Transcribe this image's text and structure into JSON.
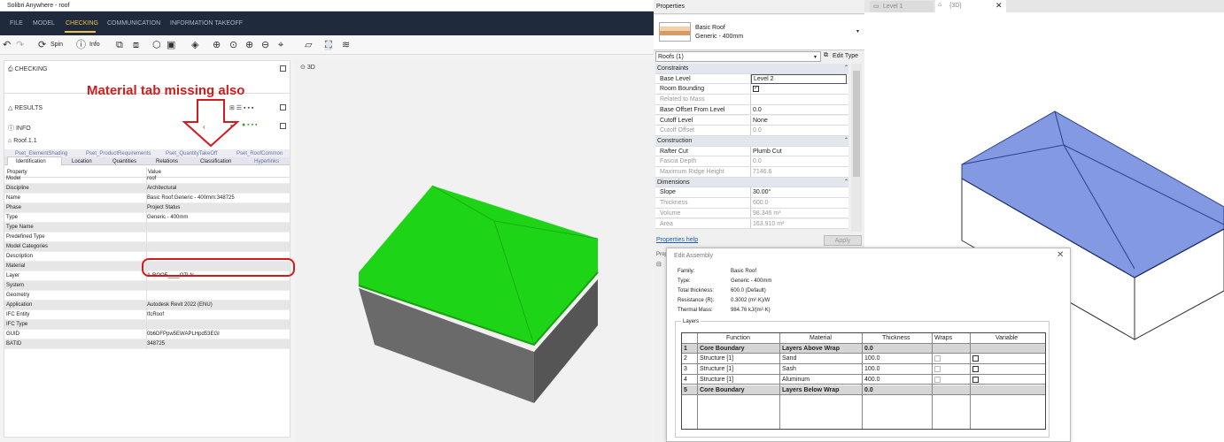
{
  "solibri": {
    "window_title": "Solibri Anywhere - roof",
    "menu": [
      "FILE",
      "MODEL",
      "CHECKING",
      "COMMUNICATION",
      "INFORMATION TAKEOFF"
    ],
    "active_menu": "CHECKING",
    "toolbar": {
      "spin_label": "Spin",
      "info_label": "Info"
    },
    "checking_title": "CHECKING",
    "results_title": "RESULTS",
    "info_title": "INFO",
    "selected_object": "Roof.1.1",
    "tabs_row1": [
      "Pset_ElementShading",
      "Pset_ProductRequirements",
      "Pset_QuantityTakeOff",
      "Pset_RoofCommon"
    ],
    "tabs_row2": [
      "Identification",
      "Location",
      "Quantities",
      "Relations",
      "Classification",
      "Hyperlinks"
    ],
    "selected_tab": "Identification",
    "table_headers": {
      "property": "Property",
      "value": "Value"
    },
    "properties": [
      {
        "name": "Model",
        "value": "roof"
      },
      {
        "name": "Discipline",
        "value": "Architectural"
      },
      {
        "name": "Name",
        "value": "Basic Roof:Generic - 400mm:348725"
      },
      {
        "name": "Phase",
        "value": "Project Status"
      },
      {
        "name": "Type",
        "value": "Generic - 400mm"
      },
      {
        "name": "Type Name",
        "value": ""
      },
      {
        "name": "Predefined Type",
        "value": ""
      },
      {
        "name": "Model Categories",
        "value": ""
      },
      {
        "name": "Description",
        "value": ""
      },
      {
        "name": "Material",
        "value": ""
      },
      {
        "name": "Layer",
        "value": "A-ROOF____OTLN"
      },
      {
        "name": "System",
        "value": ""
      },
      {
        "name": "Geometry",
        "value": ""
      },
      {
        "name": "Application",
        "value": "Autodesk Revit 2022 (ENU)"
      },
      {
        "name": "IFC Entity",
        "value": "IfcRoof"
      },
      {
        "name": "IFC Type",
        "value": ""
      },
      {
        "name": "GUID",
        "value": "0b6DFPpw5EWAPLHpd53EGI"
      },
      {
        "name": "BATID",
        "value": "348725"
      }
    ],
    "view_title": "3D",
    "annotation": "Material tab missing also",
    "colors": {
      "roof_top": "#1ed416",
      "roof_side": "#6e6e6e",
      "annotation": "#d41b1b",
      "menubar": "#1f2a3c",
      "active": "#f0c24a"
    }
  },
  "revit": {
    "properties_title": "Properties",
    "family": "Basic Roof",
    "type": "Generic - 400mm",
    "instance_filter": "Roofs (1)",
    "edit_type_label": "Edit Type",
    "sections": [
      {
        "title": "Constraints",
        "rows": [
          {
            "key": "Base Level",
            "value": "Level 2",
            "grey": false
          },
          {
            "key": "Room Bounding",
            "value": "",
            "check": true,
            "grey": false
          },
          {
            "key": "Related to Mass",
            "value": "",
            "grey": true
          },
          {
            "key": "Base Offset From Level",
            "value": "0.0",
            "grey": false
          },
          {
            "key": "Cutoff Level",
            "value": "None",
            "grey": false
          },
          {
            "key": "Cutoff Offset",
            "value": "0.0",
            "grey": true
          }
        ]
      },
      {
        "title": "Construction",
        "rows": [
          {
            "key": "Rafter Cut",
            "value": "Plumb Cut",
            "grey": false
          },
          {
            "key": "Fascia Depth",
            "value": "0.0",
            "grey": true
          },
          {
            "key": "Maximum Ridge Height",
            "value": "7146.6",
            "grey": true
          }
        ]
      },
      {
        "title": "Dimensions",
        "rows": [
          {
            "key": "Slope",
            "value": "30.00°",
            "grey": false
          },
          {
            "key": "Thickness",
            "value": "600.0",
            "grey": true
          },
          {
            "key": "Volume",
            "value": "98.346 m³",
            "grey": true
          },
          {
            "key": "Area",
            "value": "163.910 m²",
            "grey": true
          }
        ]
      }
    ],
    "properties_help": "Properties help",
    "apply_label": "Apply",
    "view_tabs": [
      "Level 1",
      "{3D}"
    ],
    "dialog": {
      "title": "Edit Assembly",
      "family_label": "Family:",
      "family_value": "Basic Roof",
      "type_label": "Type:",
      "type_value": "Generic - 400mm",
      "thickness_label": "Total thickness:",
      "thickness_value": "600.0 (Default)",
      "resistance_label": "Resistance (R):",
      "resistance_value": "0.3002 (m²·K)/W",
      "mass_label": "Thermal Mass:",
      "mass_value": "984.76 kJ/(m²·K)",
      "layers_label": "Layers",
      "columns": [
        "Function",
        "Material",
        "Thickness",
        "Wraps",
        "Variable"
      ],
      "rows": [
        {
          "n": "1",
          "function": "Core Boundary",
          "material": "Layers Above Wrap",
          "thickness": "0.0",
          "bold": true
        },
        {
          "n": "2",
          "function": "Structure [1]",
          "material": "Sand",
          "thickness": "100.0",
          "bold": false
        },
        {
          "n": "3",
          "function": "Structure [1]",
          "material": "Sash",
          "thickness": "100.0",
          "bold": false
        },
        {
          "n": "4",
          "function": "Structure [1]",
          "material": "Aluminum",
          "thickness": "400.0",
          "bold": false
        },
        {
          "n": "5",
          "function": "Core Boundary",
          "material": "Layers Below Wrap",
          "thickness": "0.0",
          "bold": true
        }
      ]
    },
    "partial_label": "Prop",
    "colors": {
      "roof_blue": "#5a78d8"
    }
  }
}
